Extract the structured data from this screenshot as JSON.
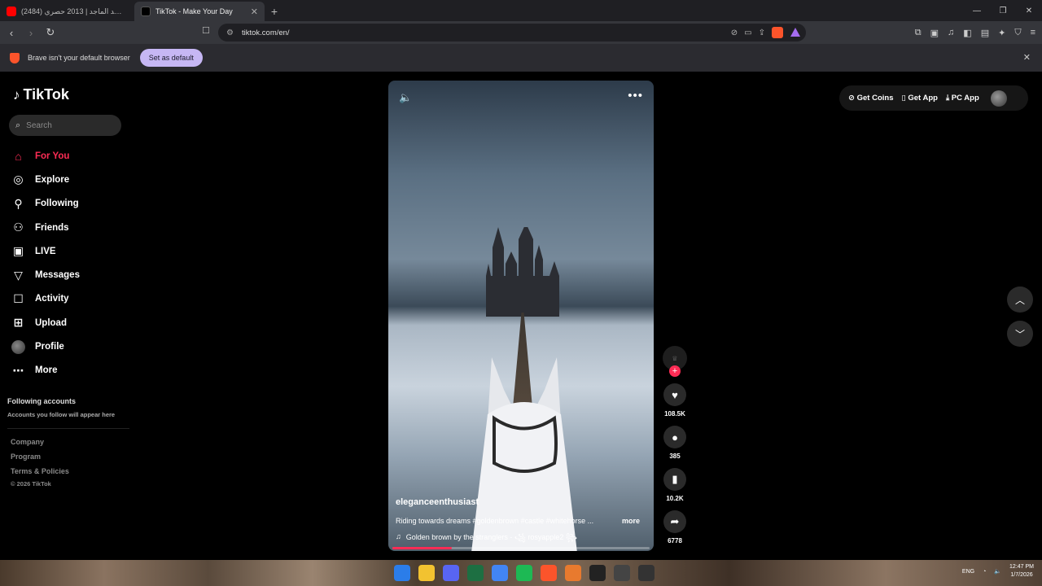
{
  "browser": {
    "tabs": [
      {
        "title": "(2484) غروبة - راشد الماجد | 2013 حصري",
        "active": false,
        "favicon_color": "#ff0000"
      },
      {
        "title": "TikTok - Make Your Day",
        "active": true,
        "favicon_color": "#000000"
      }
    ],
    "url": "tiktok.com/en/",
    "infobar": {
      "message": "Brave isn't your default browser",
      "button": "Set as default"
    }
  },
  "brand": {
    "name": "TikTok"
  },
  "search": {
    "placeholder": "Search"
  },
  "nav": [
    {
      "label": "For You",
      "icon": "home-icon"
    },
    {
      "label": "Explore",
      "icon": "compass-icon"
    },
    {
      "label": "Following",
      "icon": "person-add-icon"
    },
    {
      "label": "Friends",
      "icon": "friends-icon"
    },
    {
      "label": "LIVE",
      "icon": "live-icon"
    },
    {
      "label": "Messages",
      "icon": "send-icon"
    },
    {
      "label": "Activity",
      "icon": "message-square-icon"
    },
    {
      "label": "Upload",
      "icon": "plus-square-icon"
    },
    {
      "label": "Profile",
      "icon": "avatar-icon"
    },
    {
      "label": "More",
      "icon": "more-dots-icon"
    }
  ],
  "following_accounts": {
    "heading": "Following accounts",
    "subtext": "Accounts you follow will appear here"
  },
  "footer": {
    "links": [
      "Company",
      "Program",
      "Terms & Policies"
    ],
    "copyright": "© 2026 TikTok"
  },
  "video": {
    "username": "eleganceenthusiast",
    "description": "Riding towards dreams #goldenbrown #castle #whitehorse ...",
    "more_label": "more",
    "music": "Golden brown by the stranglers - ꧁ rosyapple2 ꧂",
    "progress": 0.23
  },
  "actions": {
    "likes": "108.5K",
    "comments": "385",
    "saves": "10.2K",
    "shares": "6778"
  },
  "topbar": {
    "coins": "Get Coins",
    "app": "Get App",
    "pc": "PC App"
  },
  "taskbar": {
    "lang": "ENG",
    "time": "12:47 PM",
    "date": "1/7/2026"
  },
  "colors": {
    "accent": "#fe2c55",
    "infobar_button": "#c6b7f4"
  }
}
